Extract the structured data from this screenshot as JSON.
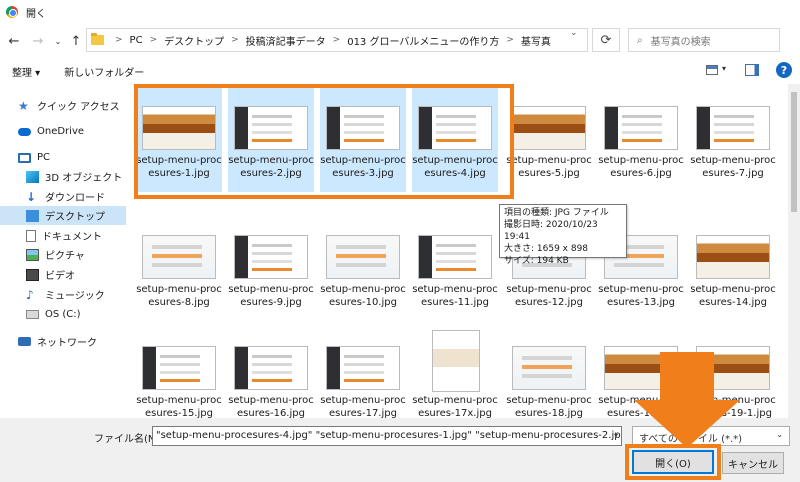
{
  "window": {
    "title": "開く"
  },
  "address": {
    "crumbs": [
      "PC",
      "デスクトップ",
      "投稿済記事データ",
      "013 グローバルメニューの作り方",
      "基写真"
    ],
    "search_placeholder": "基写真の検索"
  },
  "toolbar": {
    "organize": "整理 ▾",
    "new_folder": "新しいフォルダー",
    "help": "?"
  },
  "sidebar": {
    "items": [
      {
        "label": "クイック アクセス",
        "icon": "star-icon"
      },
      {
        "label": "OneDrive",
        "icon": "cloud-icon"
      },
      {
        "label": "PC",
        "icon": "pc-icon"
      },
      {
        "label": "3D オブジェクト",
        "icon": "3d-objects-icon"
      },
      {
        "label": "ダウンロード",
        "icon": "download-icon"
      },
      {
        "label": "デスクトップ",
        "icon": "desktop-icon"
      },
      {
        "label": "ドキュメント",
        "icon": "document-icon"
      },
      {
        "label": "ピクチャ",
        "icon": "pictures-icon"
      },
      {
        "label": "ビデオ",
        "icon": "video-icon"
      },
      {
        "label": "ミュージック",
        "icon": "music-icon"
      },
      {
        "label": "OS (C:)",
        "icon": "drive-icon"
      },
      {
        "label": "ネットワーク",
        "icon": "network-icon"
      }
    ]
  },
  "files": [
    {
      "name": "setup-menu-procesures-1.jpg",
      "selected": true,
      "style": "desert"
    },
    {
      "name": "setup-menu-procesures-2.jpg",
      "selected": true,
      "style": "app"
    },
    {
      "name": "setup-menu-procesures-3.jpg",
      "selected": true,
      "style": "app"
    },
    {
      "name": "setup-menu-procesures-4.jpg",
      "selected": true,
      "style": "app"
    },
    {
      "name": "setup-menu-procesures-5.jpg",
      "selected": false,
      "style": "desert"
    },
    {
      "name": "setup-menu-procesures-6.jpg",
      "selected": false,
      "style": "app"
    },
    {
      "name": "setup-menu-procesures-7.jpg",
      "selected": false,
      "style": "app"
    },
    {
      "name": "setup-menu-procesures-8.jpg",
      "selected": false,
      "style": "page"
    },
    {
      "name": "setup-menu-procesures-9.jpg",
      "selected": false,
      "style": "app"
    },
    {
      "name": "setup-menu-procesures-10.jpg",
      "selected": false,
      "style": "page"
    },
    {
      "name": "setup-menu-procesures-11.jpg",
      "selected": false,
      "style": "app"
    },
    {
      "name": "setup-menu-procesures-12.jpg",
      "selected": false,
      "style": "page"
    },
    {
      "name": "setup-menu-procesures-13.jpg",
      "selected": false,
      "style": "page"
    },
    {
      "name": "setup-menu-procesures-14.jpg",
      "selected": false,
      "style": "desert"
    },
    {
      "name": "setup-menu-procesures-15.jpg",
      "selected": false,
      "style": "app"
    },
    {
      "name": "setup-menu-procesures-16.jpg",
      "selected": false,
      "style": "app"
    },
    {
      "name": "setup-menu-procesures-17.jpg",
      "selected": false,
      "style": "app"
    },
    {
      "name": "setup-menu-procesures-17x.jpg",
      "selected": false,
      "style": "tall"
    },
    {
      "name": "setup-menu-procesures-18.jpg",
      "selected": false,
      "style": "page"
    },
    {
      "name": "setup-menu-procesures-19.jpg",
      "selected": false,
      "style": "desert"
    },
    {
      "name": "setup-menu-procesures-19-1.jpg",
      "selected": false,
      "style": "desert"
    }
  ],
  "tooltip": {
    "lines": [
      "項目の種類: JPG ファイル",
      "撮影日時: 2020/10/23 19:41",
      "大きさ: 1659 x 898",
      "サイズ: 194 KB"
    ]
  },
  "bottom": {
    "filename_label": "ファイル名(N):",
    "filename_value": "\"setup-menu-procesures-4.jpg\" \"setup-menu-procesures-1.jpg\" \"setup-menu-procesures-2.jpg\" \"setup-m",
    "filetype": "すべてのファイル (*.*)",
    "open_button": "開く(O)",
    "cancel_button": "キャンセル"
  },
  "colors": {
    "annotation": "#f07e1b",
    "selection": "#cce8ff",
    "accent": "#0078d7"
  }
}
